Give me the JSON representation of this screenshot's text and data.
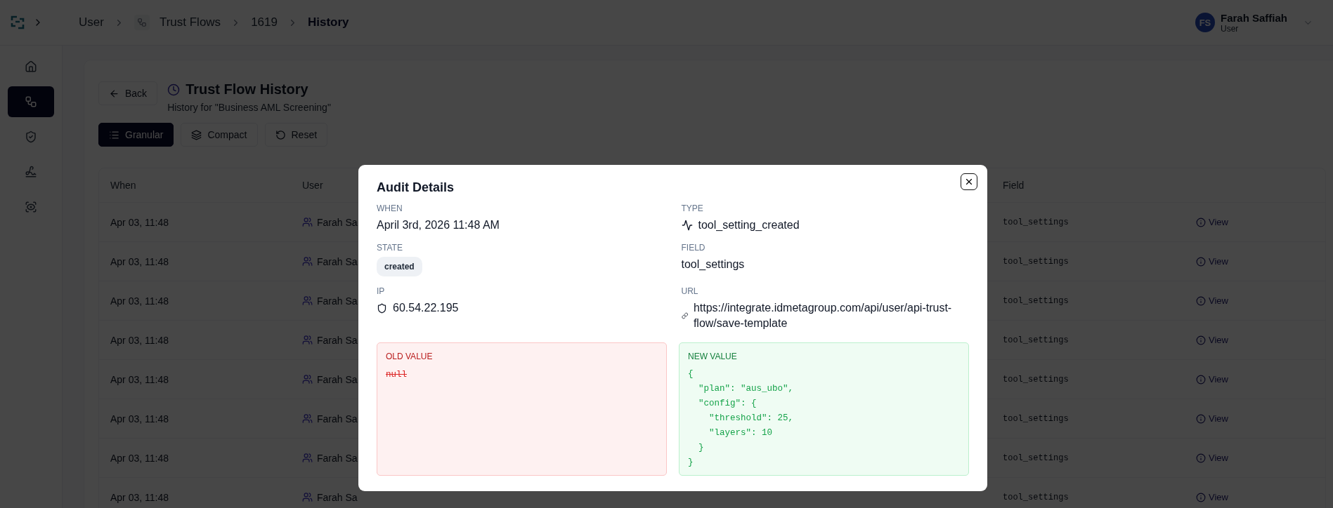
{
  "breadcrumb": [
    {
      "label": "User",
      "icon": false,
      "current": false
    },
    {
      "label": "Trust Flows",
      "icon": true,
      "current": false
    },
    {
      "label": "1619",
      "icon": false,
      "current": false
    },
    {
      "label": "History",
      "icon": false,
      "current": true
    }
  ],
  "user": {
    "initials": "FS",
    "name": "Farah Saffiah",
    "role": "User"
  },
  "sidebar": {
    "items": [
      {
        "kind": "home",
        "selected": false
      },
      {
        "kind": "flows",
        "selected": true
      },
      {
        "kind": "shield",
        "selected": false
      },
      {
        "kind": "signature",
        "selected": false
      },
      {
        "kind": "scan",
        "selected": false
      }
    ]
  },
  "page": {
    "back": "Back",
    "title": "Trust Flow History",
    "subtitle": "History for \"Business AML Screening\"",
    "view_modes": [
      {
        "kind": "list",
        "label": "Granular",
        "selected": true
      },
      {
        "kind": "layers",
        "label": "Compact",
        "selected": false
      }
    ],
    "reset": "Reset"
  },
  "table": {
    "columns": [
      "When",
      "User",
      "Field"
    ],
    "rows": [
      {
        "when": "Apr 03, 11:48",
        "user": "Farah Sa",
        "field": "tool_settings",
        "action": "View"
      },
      {
        "when": "Apr 03, 11:48",
        "user": "Farah Sa",
        "field": "tool_settings",
        "action": "View"
      },
      {
        "when": "Apr 03, 11:48",
        "user": "Farah Sa",
        "field": "tool_settings",
        "action": "View"
      },
      {
        "when": "Apr 03, 11:48",
        "user": "Farah Sa",
        "field": "tool_settings",
        "action": "View"
      },
      {
        "when": "Apr 03, 11:48",
        "user": "Farah Sa",
        "field": "tool_settings",
        "action": "View"
      },
      {
        "when": "Apr 03, 11:48",
        "user": "Farah Sa",
        "field": "tool_settings",
        "action": "View"
      },
      {
        "when": "Apr 03, 11:48",
        "user": "Farah Sa",
        "field": "tool_settings",
        "action": "View"
      },
      {
        "when": "Apr 03, 11:48",
        "user": "Farah Sa",
        "field": "tool_settings",
        "action": "View"
      }
    ]
  },
  "modal": {
    "title": "Audit Details",
    "details": [
      {
        "kind": "text",
        "label": "WHEN",
        "value": "April 3rd, 2026 11:48 AM"
      },
      {
        "kind": "type",
        "label": "TYPE",
        "value": "tool_setting_created"
      },
      {
        "kind": "badge",
        "label": "STATE",
        "value": "created"
      },
      {
        "kind": "text",
        "label": "FIELD",
        "value": "tool_settings"
      },
      {
        "kind": "ip",
        "label": "IP",
        "value": "60.54.22.195"
      },
      {
        "kind": "link",
        "label": "URL",
        "value": "https://integrate.idmetagroup.com/api/user/api-trust-flow/save-template"
      }
    ],
    "old_value": {
      "label": "OLD VALUE",
      "value": "null",
      "struck": true
    },
    "new_value": {
      "label": "NEW VALUE",
      "value": "{\n  \"plan\": \"aus_ubo\",\n  \"config\": {\n    \"threshold\": 25,\n    \"layers\": 10\n  }\n}"
    }
  }
}
